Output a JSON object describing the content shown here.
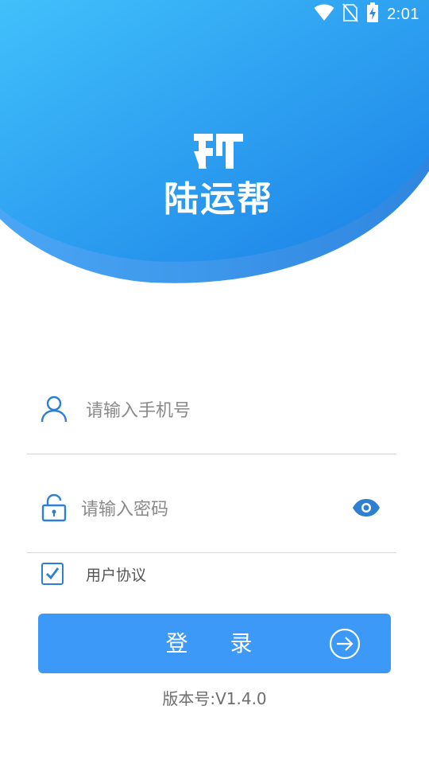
{
  "status_bar": {
    "time": "2:01",
    "icons": [
      "wifi-icon",
      "no-sim-icon",
      "battery-charging-icon"
    ]
  },
  "brand": {
    "app_name": "陆运帮",
    "mark": "logo-mark"
  },
  "form": {
    "phone_placeholder": "请输入手机号",
    "phone_icon": "user-icon",
    "password_placeholder": "请输入密码",
    "password_icon": "lock-icon",
    "visibility_icon": "eye-icon",
    "agreement_label": "用户协议",
    "agreement_checked": true
  },
  "login_button": {
    "label": "登 录",
    "icon": "arrow-right-circle-icon"
  },
  "version_text": "版本号:V1.4.0",
  "colors": {
    "primary": "#3c99f7",
    "hero_start": "#3fbcf9",
    "hero_end": "#1a7fe4",
    "accent": "#2e7fd1"
  }
}
